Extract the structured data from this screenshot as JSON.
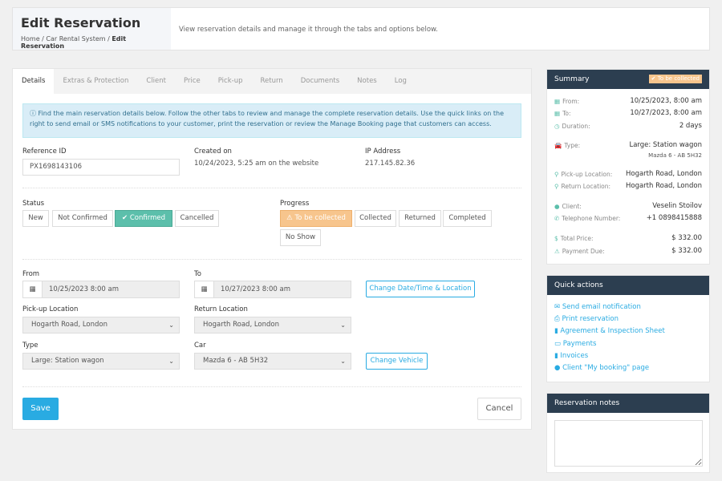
{
  "header": {
    "title": "Edit Reservation",
    "breadcrumb": [
      "Home",
      "Car Rental System",
      "Edit Reservation"
    ],
    "description": "View reservation details and manage it through the tabs and options below."
  },
  "tabs": [
    "Details",
    "Extras & Protection",
    "Client",
    "Price",
    "Pick-up",
    "Return",
    "Documents",
    "Notes",
    "Log"
  ],
  "info": "Find the main reservation details below. Follow the other tabs to review and manage the complete reservation details. Use the quick links on the right to send email or SMS notifications to your customer, print the reservation or review the Manage Booking page that customers can access.",
  "details": {
    "reference_label": "Reference ID",
    "reference": "PX1698143106",
    "created_label": "Created on",
    "created": "10/24/2023, 5:25 am on the website",
    "ip_label": "IP Address",
    "ip": "217.145.82.36"
  },
  "status": {
    "label": "Status",
    "options": [
      "New",
      "Not Confirmed",
      "Confirmed",
      "Cancelled"
    ],
    "selected": "Confirmed"
  },
  "progress": {
    "label": "Progress",
    "options": [
      "To be collected",
      "Collected",
      "Returned",
      "Completed",
      "No Show"
    ],
    "selected": "To be collected"
  },
  "form": {
    "from_label": "From",
    "from": "10/25/2023 8:00 am",
    "to_label": "To",
    "to": "10/27/2023 8:00 am",
    "change_dt": "Change Date/Time & Location",
    "pickup_label": "Pick-up Location",
    "pickup": "Hogarth Road, London",
    "return_label": "Return Location",
    "return": "Hogarth Road, London",
    "type_label": "Type",
    "type": "Large: Station wagon",
    "car_label": "Car",
    "car": "Mazda 6 - AB 5H32",
    "change_vehicle": "Change Vehicle",
    "save": "Save",
    "cancel": "Cancel"
  },
  "summary": {
    "title": "Summary",
    "badge": "To be collected",
    "rows": [
      {
        "label": "From:",
        "value": "10/25/2023, 8:00 am"
      },
      {
        "label": "To:",
        "value": "10/27/2023, 8:00 am"
      },
      {
        "label": "Duration:",
        "value": "2 days"
      },
      {
        "label": "Type:",
        "value": "Large: Station wagon",
        "sub": "Mazda 6 - AB 5H32"
      },
      {
        "label": "Pick-up Location:",
        "value": "Hogarth Road, London"
      },
      {
        "label": "Return Location:",
        "value": "Hogarth Road, London"
      },
      {
        "label": "Client:",
        "value": "Veselin Stoilov"
      },
      {
        "label": "Telephone Number:",
        "value": "+1 0898415888"
      },
      {
        "label": "Total Price:",
        "value": "$ 332.00"
      },
      {
        "label": "Payment Due:",
        "value": "$ 332.00"
      }
    ]
  },
  "quick_actions": {
    "title": "Quick actions",
    "items": [
      "Send email notification",
      "Print reservation",
      "Agreement & Inspection Sheet",
      "Payments",
      "Invoices",
      "Client \"My booking\" page"
    ]
  },
  "notes": {
    "title": "Reservation notes",
    "value": ""
  },
  "colors": {
    "accent": "#29abe2",
    "confirmed": "#5cbfab",
    "to_be_collected": "#f7c58d",
    "panel_header": "#2c3e50"
  }
}
